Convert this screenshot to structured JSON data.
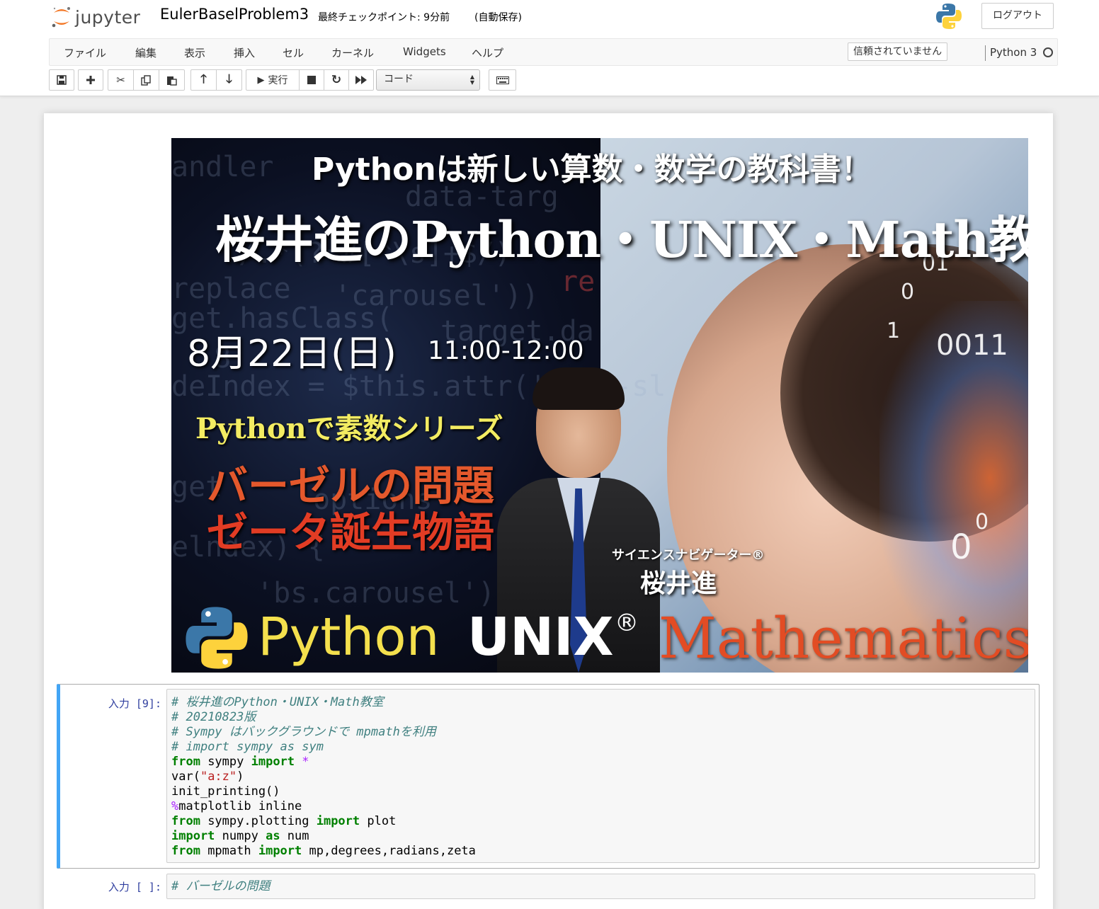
{
  "header": {
    "logo_text": "jupyter",
    "notebook_name": "EulerBaselProblem3",
    "checkpoint": "最終チェックポイント: 9分前",
    "autosave": "(自動保存)",
    "logout_label": "ログアウト"
  },
  "menubar": {
    "items": [
      "ファイル",
      "編集",
      "表示",
      "挿入",
      "セル",
      "カーネル",
      "Widgets",
      "ヘルプ"
    ],
    "trust_label": "信頼されていません",
    "kernel_name": "Python 3"
  },
  "toolbar": {
    "run_label": "実行",
    "cell_type": "コード",
    "icons": [
      "save-icon",
      "plus-icon",
      "scissors-icon",
      "copy-icon",
      "paste-icon",
      "arrow-up-icon",
      "arrow-down-icon",
      "play-icon",
      "stop-icon",
      "restart-icon",
      "fast-forward-icon",
      "keyboard-icon"
    ]
  },
  "banner": {
    "title1": "Pythonは新しい算数・数学の教科書！",
    "title2": "桜井進のPython・UNIX・Math教室",
    "date": "8月22日(日)",
    "time": "11:00-12:00",
    "series": "Pythonで素数シリーズ",
    "topic1": "バーゼルの問題",
    "topic2": "ゼータ誕生物語",
    "navigator": "サイエンスナビゲーター®",
    "presenter": "桜井進",
    "brand_python": "Python",
    "brand_unix": "UNIX",
    "brand_reg": "®",
    "brand_math": "Mathematics",
    "code_bg": [
      "andler",
      "data-targ",
      "/.*(?=#[^\\s]+$/)",
      "re",
      "replace",
      "'carousel'))",
      "get.hasClass(",
      "8",
      "target.da",
      "deIndex = $this.attr('data-sl",
      "get",
      "options",
      "elndex) {",
      "'bs.carousel')"
    ],
    "digits": [
      "01",
      "0",
      "1",
      "0011",
      "0",
      "0"
    ]
  },
  "cells": [
    {
      "prompt": "入力 [9]:",
      "lines": [
        [
          {
            "t": "# 桜井進のPython・UNIX・Math教室",
            "c": "comment"
          }
        ],
        [
          {
            "t": "# 20210823版",
            "c": "comment"
          }
        ],
        [
          {
            "t": "# Sympy はバックグラウンドで mpmathを利用",
            "c": "comment"
          }
        ],
        [
          {
            "t": "# import sympy as sym",
            "c": "comment"
          }
        ],
        [
          {
            "t": "from",
            "c": "kw"
          },
          {
            "t": " sympy ",
            "c": ""
          },
          {
            "t": "import",
            "c": "kw"
          },
          {
            "t": " ",
            "c": ""
          },
          {
            "t": "*",
            "c": "op"
          }
        ],
        [
          {
            "t": "var(",
            "c": ""
          },
          {
            "t": "\"a:z\"",
            "c": "str"
          },
          {
            "t": ")",
            "c": ""
          }
        ],
        [
          {
            "t": "init_printing()",
            "c": ""
          }
        ],
        [
          {
            "t": "%",
            "c": "op"
          },
          {
            "t": "matplotlib inline",
            "c": ""
          }
        ],
        [
          {
            "t": "from",
            "c": "kw"
          },
          {
            "t": " sympy.plotting ",
            "c": ""
          },
          {
            "t": "import",
            "c": "kw"
          },
          {
            "t": " plot",
            "c": ""
          }
        ],
        [
          {
            "t": "import",
            "c": "kw"
          },
          {
            "t": " numpy ",
            "c": ""
          },
          {
            "t": "as",
            "c": "kw"
          },
          {
            "t": " num",
            "c": ""
          }
        ],
        [
          {
            "t": "from",
            "c": "kw"
          },
          {
            "t": " mpmath ",
            "c": ""
          },
          {
            "t": "import",
            "c": "kw"
          },
          {
            "t": " mp,degrees,radians,zeta",
            "c": ""
          }
        ]
      ]
    },
    {
      "prompt": "入力 [ ]:",
      "lines": [
        [
          {
            "t": "# バーゼルの問題",
            "c": "comment"
          }
        ]
      ]
    }
  ],
  "colors": {
    "accent_blue": "#42a5f5",
    "prompt_blue": "#303f9f",
    "comment": "#408080",
    "keyword": "#008000",
    "string": "#ba2121",
    "operator": "#aa22ff",
    "jupyter_orange": "#f37726"
  }
}
